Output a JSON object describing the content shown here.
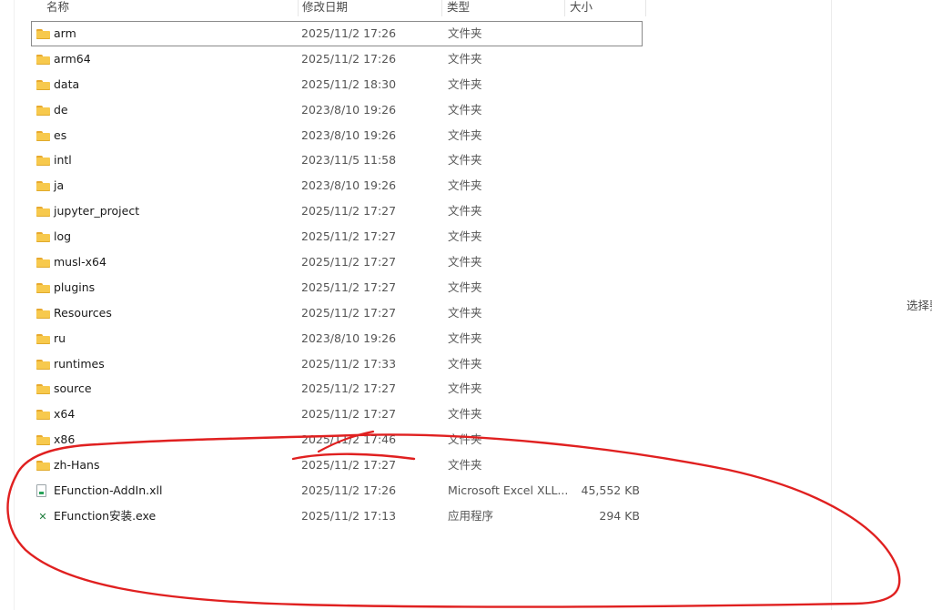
{
  "columns": {
    "name": "名称",
    "date": "修改日期",
    "type": "类型",
    "size": "大小"
  },
  "files": [
    {
      "icon": "folder-icon",
      "name": "arm",
      "date": "2025/11/2 17:26",
      "type": "文件夹",
      "size": ""
    },
    {
      "icon": "folder-icon",
      "name": "arm64",
      "date": "2025/11/2 17:26",
      "type": "文件夹",
      "size": ""
    },
    {
      "icon": "folder-icon",
      "name": "data",
      "date": "2025/11/2 18:30",
      "type": "文件夹",
      "size": ""
    },
    {
      "icon": "folder-icon",
      "name": "de",
      "date": "2023/8/10 19:26",
      "type": "文件夹",
      "size": ""
    },
    {
      "icon": "folder-icon",
      "name": "es",
      "date": "2023/8/10 19:26",
      "type": "文件夹",
      "size": ""
    },
    {
      "icon": "folder-icon",
      "name": "intl",
      "date": "2023/11/5 11:58",
      "type": "文件夹",
      "size": ""
    },
    {
      "icon": "folder-icon",
      "name": "ja",
      "date": "2023/8/10 19:26",
      "type": "文件夹",
      "size": ""
    },
    {
      "icon": "folder-icon",
      "name": "jupyter_project",
      "date": "2025/11/2 17:27",
      "type": "文件夹",
      "size": ""
    },
    {
      "icon": "folder-icon",
      "name": "log",
      "date": "2025/11/2 17:27",
      "type": "文件夹",
      "size": ""
    },
    {
      "icon": "folder-icon",
      "name": "musl-x64",
      "date": "2025/11/2 17:27",
      "type": "文件夹",
      "size": ""
    },
    {
      "icon": "folder-icon",
      "name": "plugins",
      "date": "2025/11/2 17:27",
      "type": "文件夹",
      "size": ""
    },
    {
      "icon": "folder-icon",
      "name": "Resources",
      "date": "2025/11/2 17:27",
      "type": "文件夹",
      "size": ""
    },
    {
      "icon": "folder-icon",
      "name": "ru",
      "date": "2023/8/10 19:26",
      "type": "文件夹",
      "size": ""
    },
    {
      "icon": "folder-icon",
      "name": "runtimes",
      "date": "2025/11/2 17:33",
      "type": "文件夹",
      "size": ""
    },
    {
      "icon": "folder-icon",
      "name": "source",
      "date": "2025/11/2 17:27",
      "type": "文件夹",
      "size": ""
    },
    {
      "icon": "folder-icon",
      "name": "x64",
      "date": "2025/11/2 17:27",
      "type": "文件夹",
      "size": ""
    },
    {
      "icon": "folder-icon",
      "name": "x86",
      "date": "2025/11/2 17:46",
      "type": "文件夹",
      "size": ""
    },
    {
      "icon": "folder-icon",
      "name": "zh-Hans",
      "date": "2025/11/2 17:27",
      "type": "文件夹",
      "size": ""
    },
    {
      "icon": "excel-addin-file-icon",
      "name": "EFunction-AddIn.xll",
      "date": "2025/11/2 17:26",
      "type": "Microsoft Excel XLL...",
      "size": "45,552 KB"
    },
    {
      "icon": "excel-installer-exe-icon",
      "name": "EFunction安装.exe",
      "date": "2025/11/2 17:13",
      "type": "应用程序",
      "size": "294 KB"
    }
  ],
  "details_pane": {
    "hint_text": "选择要"
  },
  "colors": {
    "folder": "#f7c94d",
    "annotation": "#e02020",
    "excel_green": "#27a35a"
  }
}
